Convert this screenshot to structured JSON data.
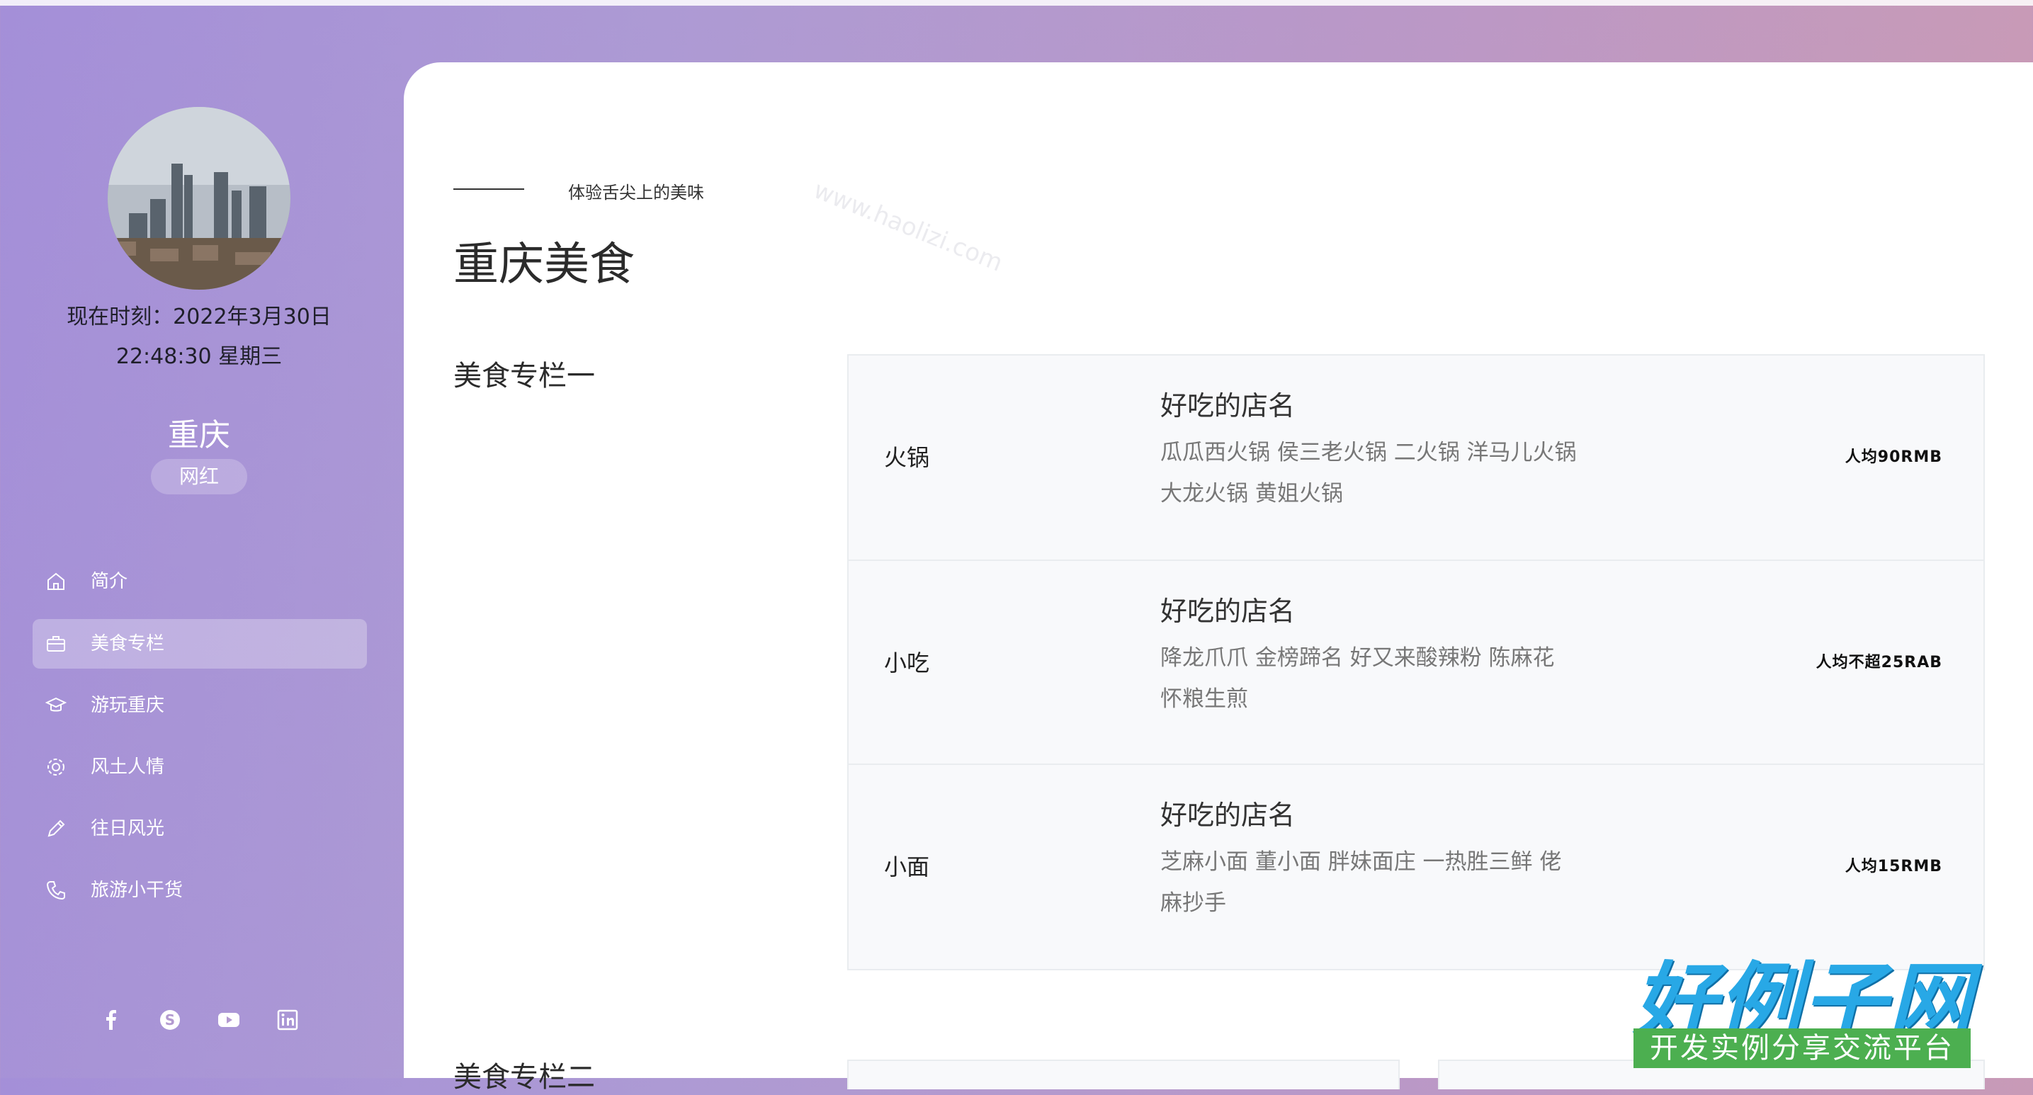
{
  "sidebar": {
    "time_line1": "现在时刻：2022年3月30日",
    "time_line2": "22:48:30  星期三",
    "city": "重庆",
    "tag": "网红",
    "nav": [
      {
        "label": "简介",
        "icon": "home-icon",
        "active": false
      },
      {
        "label": "美食专栏",
        "icon": "briefcase-icon",
        "active": true
      },
      {
        "label": "游玩重庆",
        "icon": "graduation-cap-icon",
        "active": false
      },
      {
        "label": "风土人情",
        "icon": "gear-icon",
        "active": false
      },
      {
        "label": "往日风光",
        "icon": "pencil-icon",
        "active": false
      },
      {
        "label": "旅游小干货",
        "icon": "phone-icon",
        "active": false
      }
    ],
    "social": [
      "facebook-icon",
      "skype-icon",
      "youtube-icon",
      "linkedin-icon"
    ]
  },
  "main": {
    "eyebrow": "体验舌尖上的美味",
    "title": "重庆美食",
    "section1": "美食专栏一",
    "section2": "美食专栏二",
    "foods": [
      {
        "category": "火锅",
        "heading": "好吃的店名",
        "desc": "瓜瓜西火锅 侯三老火锅 二火锅 洋马儿火锅 大龙火锅 黄姐火锅",
        "price": "人均90RMB"
      },
      {
        "category": "小吃",
        "heading": "好吃的店名",
        "desc": "降龙爪爪 金榜蹄名 好又来酸辣粉 陈麻花 怀粮生煎",
        "price": "人均不超25RAB"
      },
      {
        "category": "小面",
        "heading": "好吃的店名",
        "desc": "芝麻小面 董小面 胖妹面庄 一热胜三鲜 佬麻抄手",
        "price": "人均15RMB"
      }
    ]
  },
  "watermark": {
    "text": "www.haolizi.com",
    "logo": "好例子网",
    "logo_sub": "开发实例分享交流平台"
  },
  "colors": {
    "gradient_start": "#a48fd8",
    "gradient_end": "#cc9bb2",
    "panel": "#ffffff",
    "card": "#f8f9fb"
  }
}
